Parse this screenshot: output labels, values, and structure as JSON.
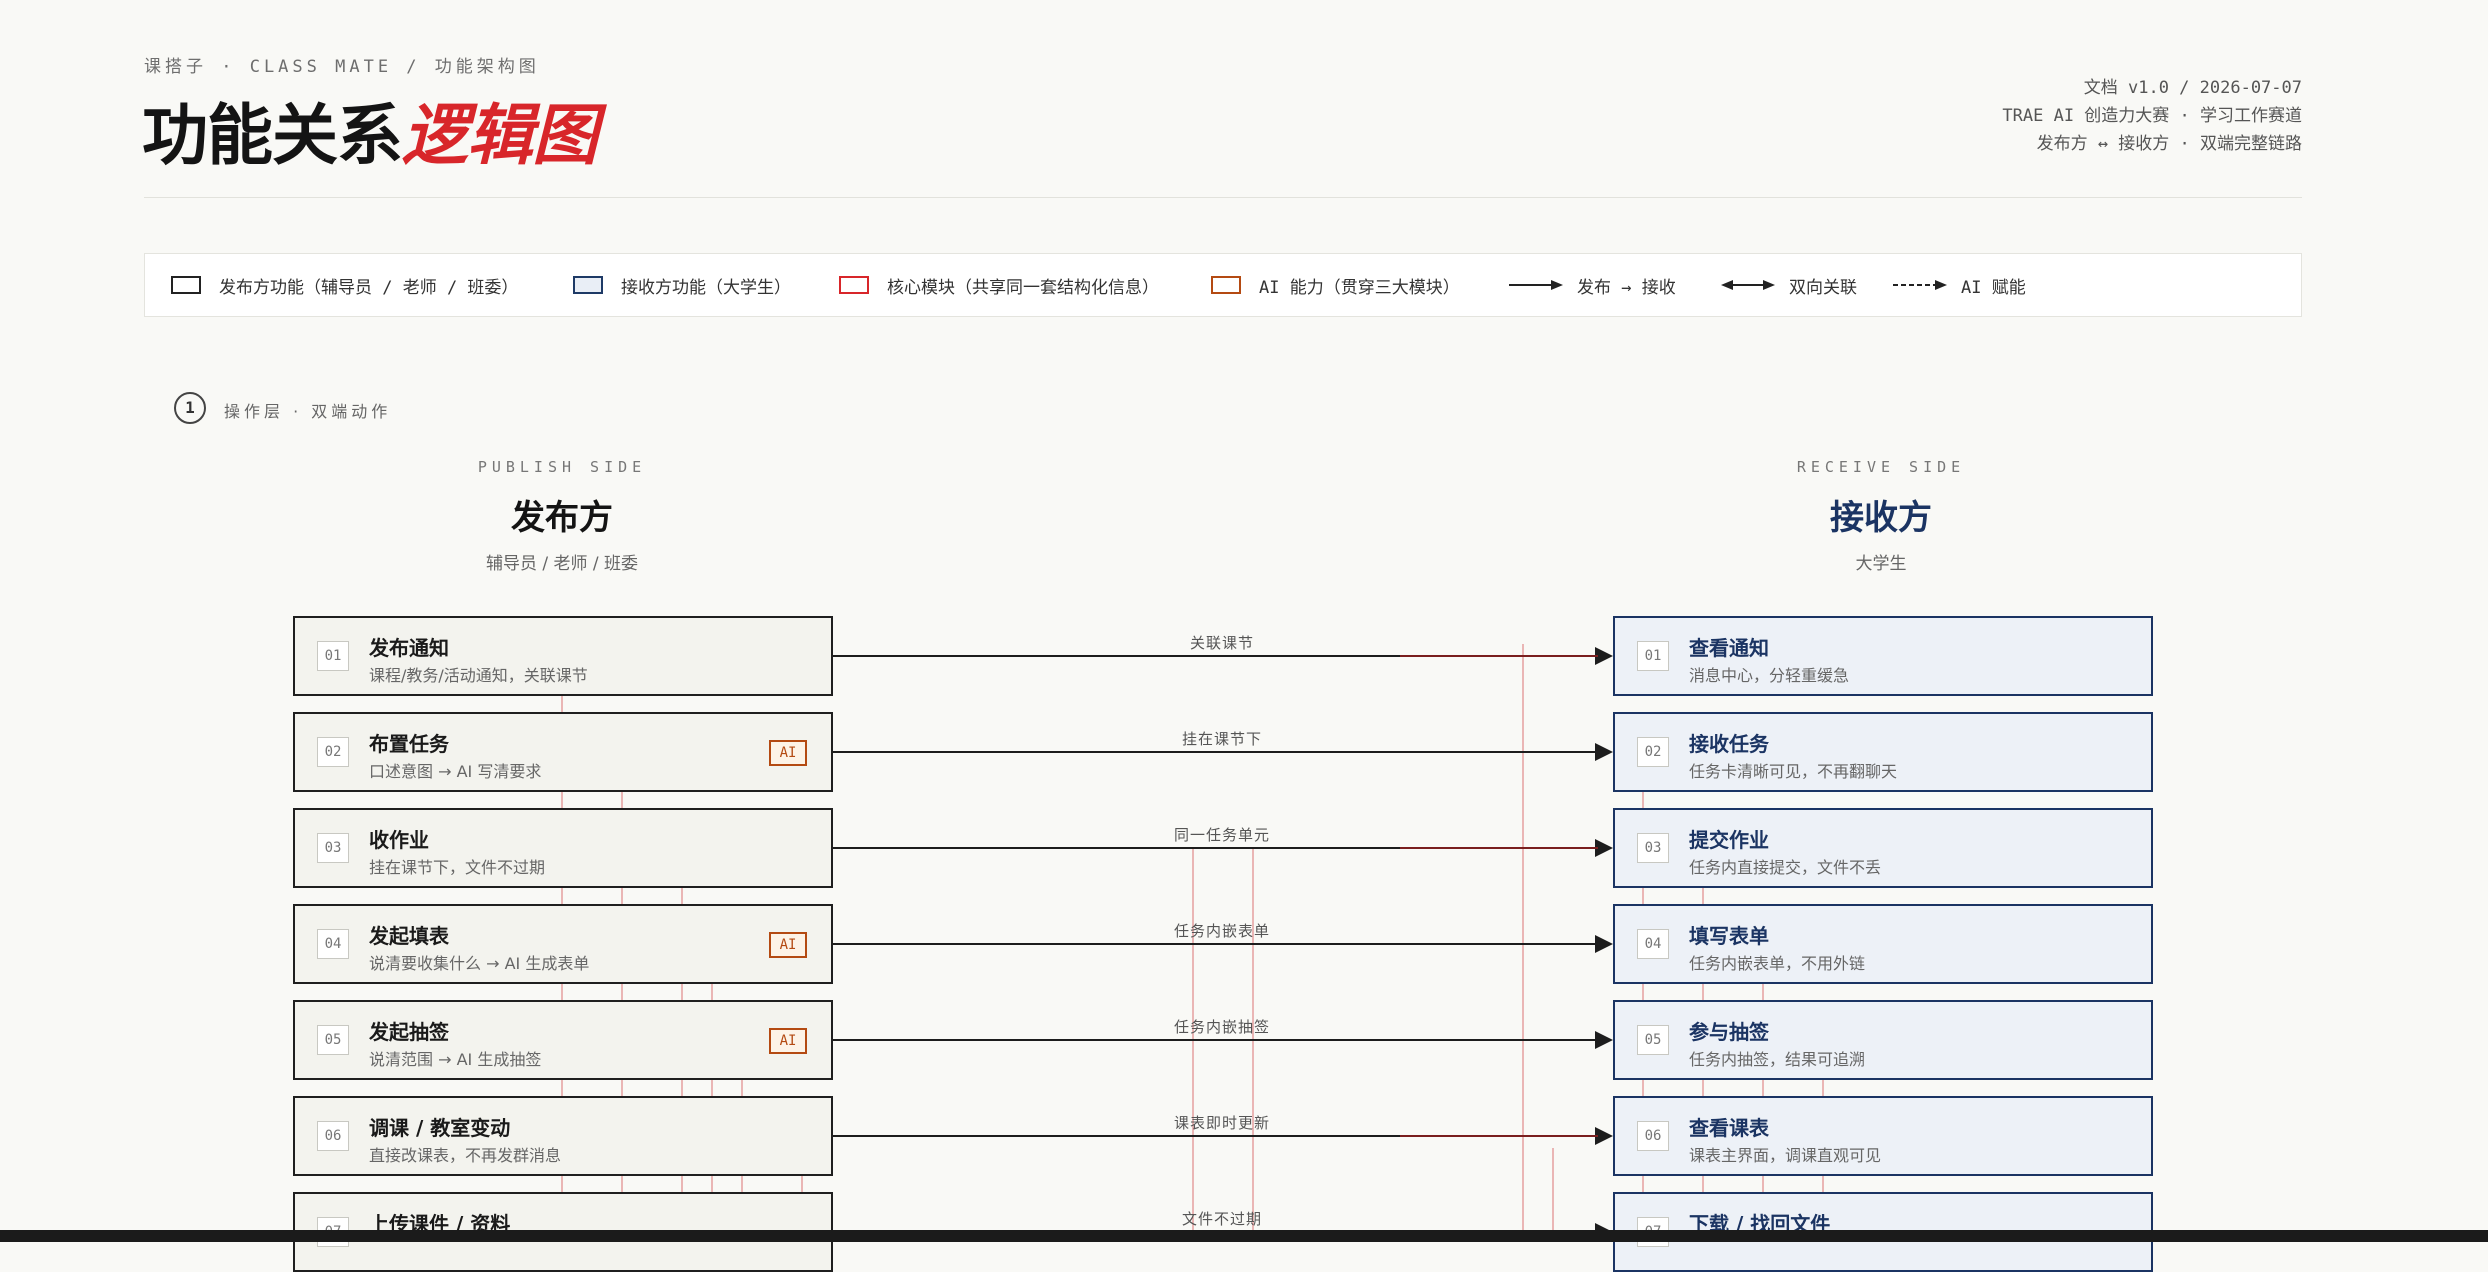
{
  "header": {
    "breadcrumb": "课搭子 · CLASS MATE / 功能架构图",
    "title_main": "功能关系",
    "title_accent": "逻辑图",
    "meta": [
      "文档 v1.0 / 2026-07-07",
      "TRAE AI 创造力大赛 · 学习工作赛道",
      "发布方 ↔ 接收方 · 双端完整链路"
    ]
  },
  "legend": {
    "publisher": "发布方功能（辅导员 / 老师 / 班委）",
    "receiver": "接收方功能（大学生）",
    "core": "核心模块（共享同一套结构化信息）",
    "ai": "AI 能力（贯穿三大模块）",
    "publish_arrow": "发布 → 接收",
    "bidirectional": "双向关联",
    "ai_empower": "AI 赋能"
  },
  "section": {
    "number": "1",
    "label": "操作层 · 双端动作"
  },
  "publish_side": {
    "en": "PUBLISH SIDE",
    "zh": "发布方",
    "sub": "辅导员 / 老师 / 班委"
  },
  "receive_side": {
    "en": "RECEIVE SIDE",
    "zh": "接收方",
    "sub": "大学生"
  },
  "rows": [
    {
      "num": "01",
      "pub_name": "发布通知",
      "pub_desc": "课程/教务/活动通知，关联课节",
      "ai": "",
      "link": "关联课节",
      "rec_name": "查看通知",
      "rec_desc": "消息中心，分轻重缓急"
    },
    {
      "num": "02",
      "pub_name": "布置任务",
      "pub_desc": "口述意图 → AI 写清要求",
      "ai": "AI",
      "link": "挂在课节下",
      "rec_name": "接收任务",
      "rec_desc": "任务卡清晰可见，不再翻聊天"
    },
    {
      "num": "03",
      "pub_name": "收作业",
      "pub_desc": "挂在课节下，文件不过期",
      "ai": "",
      "link": "同一任务单元",
      "rec_name": "提交作业",
      "rec_desc": "任务内直接提交，文件不丢"
    },
    {
      "num": "04",
      "pub_name": "发起填表",
      "pub_desc": "说清要收集什么 → AI 生成表单",
      "ai": "AI",
      "link": "任务内嵌表单",
      "rec_name": "填写表单",
      "rec_desc": "任务内嵌表单，不用外链"
    },
    {
      "num": "05",
      "pub_name": "发起抽签",
      "pub_desc": "说清范围 → AI 生成抽签",
      "ai": "AI",
      "link": "任务内嵌抽签",
      "rec_name": "参与抽签",
      "rec_desc": "任务内抽签，结果可追溯"
    },
    {
      "num": "06",
      "pub_name": "调课 / 教室变动",
      "pub_desc": "直接改课表，不再发群消息",
      "ai": "",
      "link": "课表即时更新",
      "rec_name": "查看课表",
      "rec_desc": "课表主界面，调课直观可见"
    },
    {
      "num": "07",
      "pub_name": "上传课件 / 资料",
      "pub_desc": "",
      "ai": "",
      "link": "文件不过期",
      "rec_name": "下载 / 找回文件",
      "rec_desc": ""
    }
  ],
  "colors": {
    "accent": "#d8262a",
    "receiver": "#1b3463",
    "ai": "#b44a12"
  }
}
